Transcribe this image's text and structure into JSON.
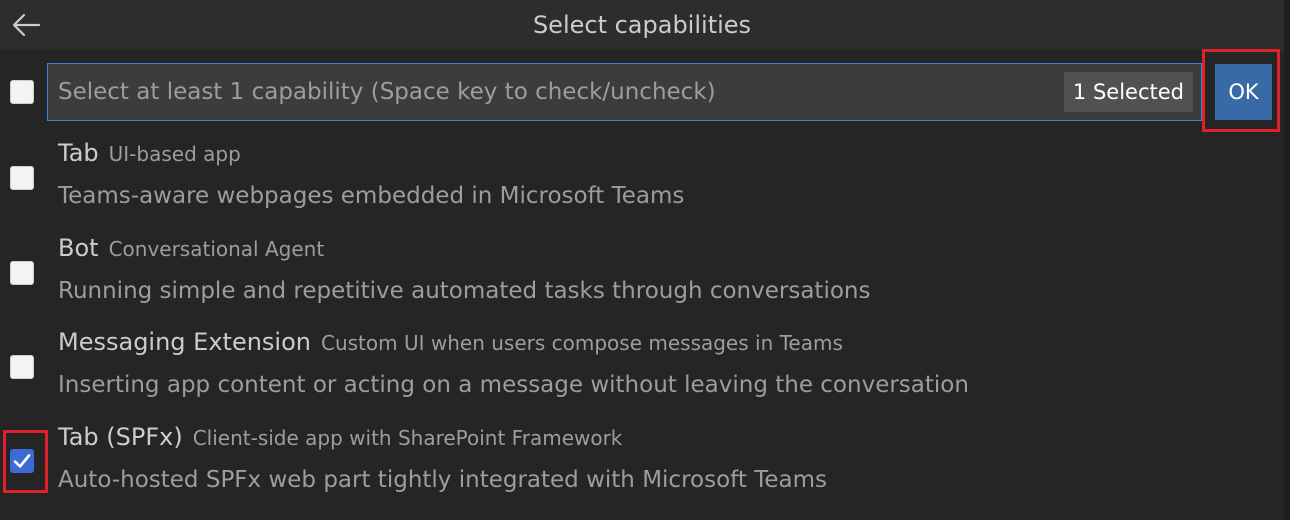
{
  "header": {
    "title": "Select capabilities",
    "back_icon": "arrow-left-icon"
  },
  "input": {
    "placeholder": "Select at least 1 capability (Space key to check/uncheck)",
    "value": "",
    "select_all_checked": false
  },
  "selected_count_label": "1 Selected",
  "ok_label": "OK",
  "items": [
    {
      "label": "Tab",
      "description": "UI-based app",
      "detail": "Teams-aware webpages embedded in Microsoft Teams",
      "checked": false
    },
    {
      "label": "Bot",
      "description": "Conversational Agent",
      "detail": "Running simple and repetitive automated tasks through conversations",
      "checked": false
    },
    {
      "label": "Messaging Extension",
      "description": "Custom UI when users compose messages in Teams",
      "detail": "Inserting app content or acting on a message without leaving the conversation",
      "checked": false
    },
    {
      "label": "Tab (SPFx)",
      "description": "Client-side app with SharePoint Framework",
      "detail": "Auto-hosted SPFx web part tightly integrated with Microsoft Teams",
      "checked": true
    }
  ],
  "colors": {
    "background": "#252526",
    "title_bar": "#2d2d2d",
    "input_border": "#3b84d8",
    "ok_button": "#3a6aa6",
    "checkbox_checked": "#3c6bd5",
    "highlight": "#e0202a"
  }
}
